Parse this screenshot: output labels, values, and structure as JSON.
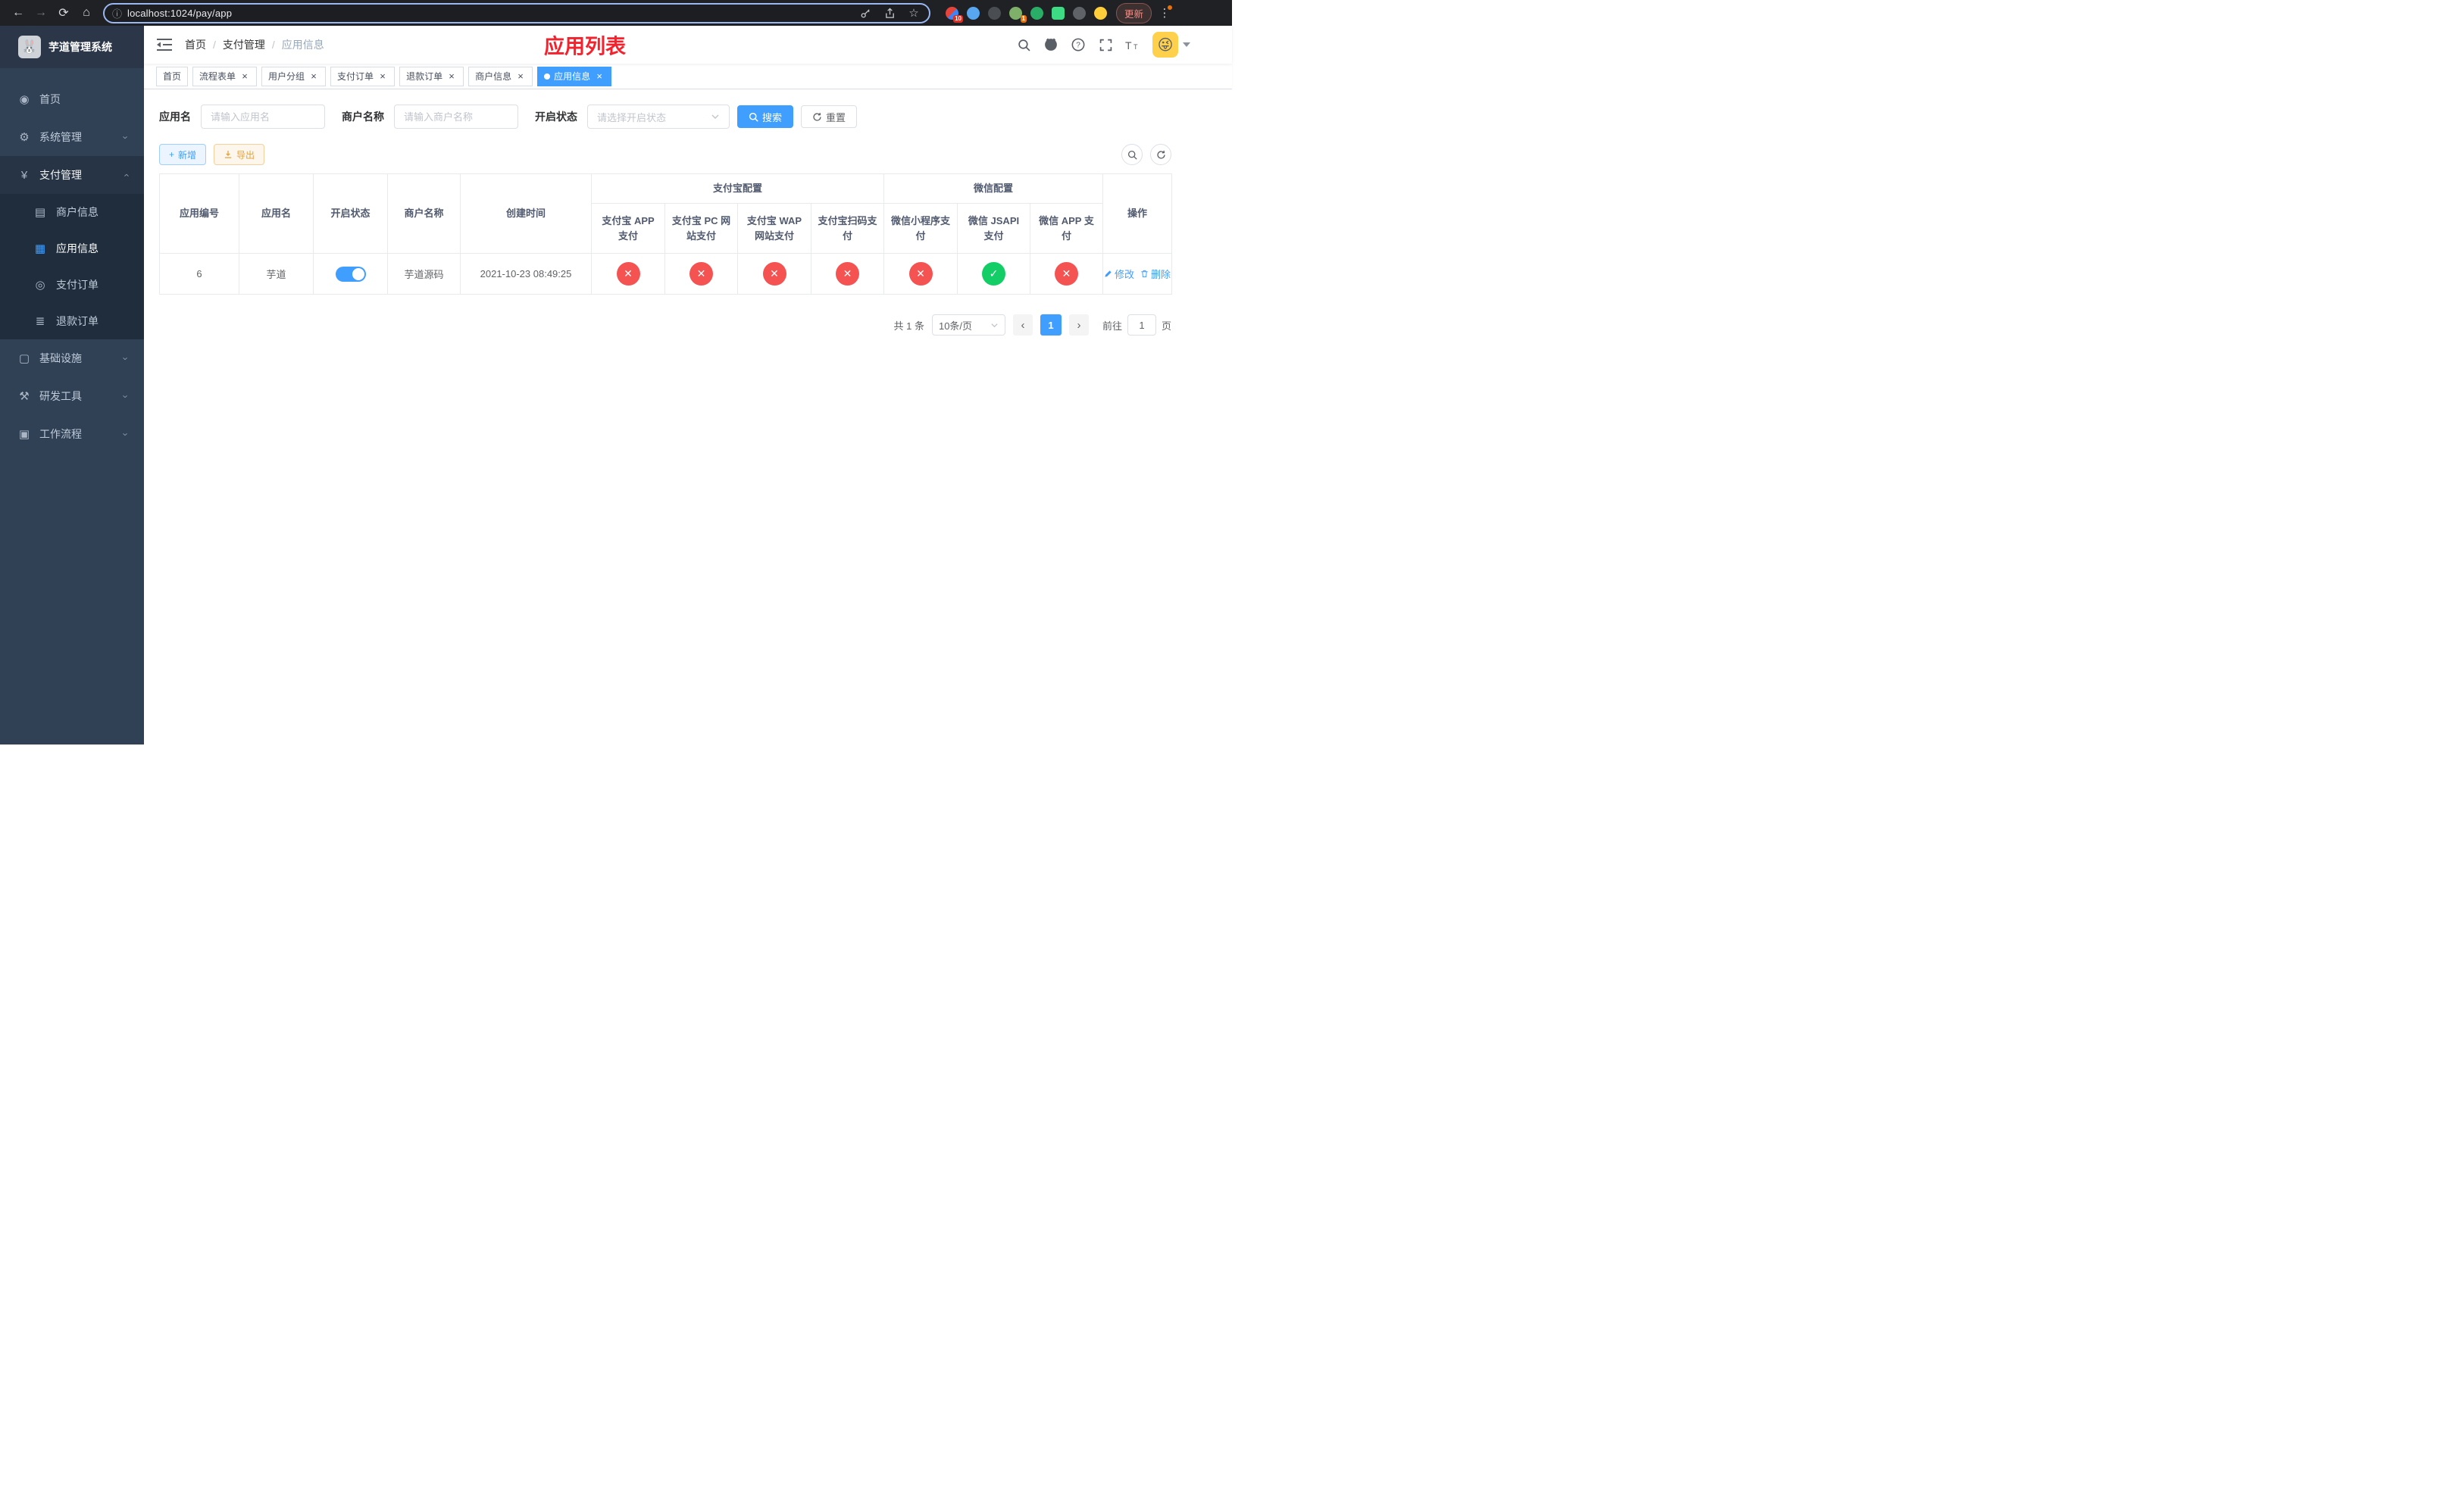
{
  "browser": {
    "url": "localhost:1024/pay/app",
    "update_label": "更新",
    "ext_badge_a": "10",
    "ext_badge_b": "1"
  },
  "sidebar": {
    "title": "芋道管理系统",
    "items": [
      {
        "icon": "dashboard-icon",
        "glyph": "◉",
        "label": "首页"
      },
      {
        "icon": "gear-icon",
        "glyph": "⚙",
        "label": "系统管理"
      },
      {
        "icon": "yen-icon",
        "glyph": "¥",
        "label": "支付管理",
        "children": [
          {
            "icon": "bank-card-icon",
            "glyph": "▤",
            "label": "商户信息"
          },
          {
            "icon": "app-grid-icon",
            "glyph": "▦",
            "label": "应用信息"
          },
          {
            "icon": "order-icon",
            "glyph": "◎",
            "label": "支付订单"
          },
          {
            "icon": "refund-doc-icon",
            "glyph": "≣",
            "label": "退款订单"
          }
        ]
      },
      {
        "icon": "infrastructure-icon",
        "glyph": "▢",
        "label": "基础设施"
      },
      {
        "icon": "dev-tools-icon",
        "glyph": "⚒",
        "label": "研发工具"
      },
      {
        "icon": "workflow-icon",
        "glyph": "▣",
        "label": "工作流程"
      }
    ]
  },
  "navbar": {
    "breadcrumb": [
      "首页",
      "支付管理",
      "应用信息"
    ],
    "title": "应用列表"
  },
  "tabs": [
    {
      "label": "首页",
      "closable": false,
      "active": false
    },
    {
      "label": "流程表单",
      "closable": true,
      "active": false
    },
    {
      "label": "用户分组",
      "closable": true,
      "active": false
    },
    {
      "label": "支付订单",
      "closable": true,
      "active": false
    },
    {
      "label": "退款订单",
      "closable": true,
      "active": false
    },
    {
      "label": "商户信息",
      "closable": true,
      "active": false
    },
    {
      "label": "应用信息",
      "closable": true,
      "active": true
    }
  ],
  "filters": {
    "app_name_label": "应用名",
    "app_name_placeholder": "请输入应用名",
    "merchant_label": "商户名称",
    "merchant_placeholder": "请输入商户名称",
    "status_label": "开启状态",
    "status_placeholder": "请选择开启状态",
    "search_label": "搜索",
    "reset_label": "重置"
  },
  "toolbar": {
    "add_label": "新增",
    "export_label": "导出"
  },
  "table": {
    "main_columns": [
      "应用编号",
      "应用名",
      "开启状态",
      "商户名称",
      "创建时间",
      "操作"
    ],
    "groups": [
      {
        "label": "支付宝配置"
      },
      {
        "label": "微信配置"
      }
    ],
    "sub_columns": [
      "支付宝 APP 支付",
      "支付宝 PC 网站支付",
      "支付宝 WAP 网站支付",
      "支付宝扫码支付",
      "微信小程序支付",
      "微信 JSAPI 支付",
      "微信 APP 支付"
    ],
    "rows": [
      {
        "id": "6",
        "name": "芋道",
        "enabled": true,
        "merchant": "芋道源码",
        "created_at": "2021-10-23 08:49:25",
        "statuses": [
          false,
          false,
          false,
          false,
          false,
          true,
          false
        ],
        "actions": {
          "edit": "修改",
          "delete": "删除"
        }
      }
    ]
  },
  "pagination": {
    "total": "共 1 条",
    "page_size": "10条/页",
    "page": "1",
    "goto_label": "前往",
    "goto_value": "1",
    "goto_unit": "页"
  }
}
